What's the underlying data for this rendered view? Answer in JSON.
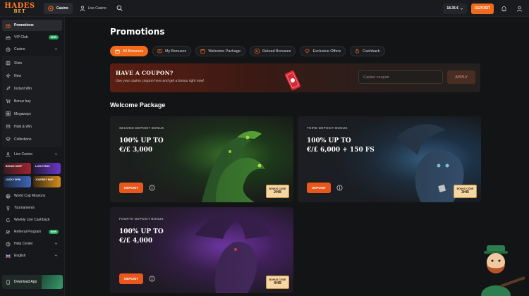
{
  "topbar": {
    "logo_line1": "HADES",
    "logo_line2": "BET",
    "nav": [
      {
        "label": "Casino",
        "active": true
      },
      {
        "label": "Live Casino",
        "active": false
      }
    ],
    "balance": "18.35 €",
    "deposit_label": "DEPOSIT"
  },
  "sidebar": {
    "items_top": [
      {
        "label": "Promotions"
      },
      {
        "label": "VIP Club",
        "badge": "NEW"
      },
      {
        "label": "Casino"
      }
    ],
    "casino_sub": [
      {
        "label": "Slots"
      },
      {
        "label": "New"
      },
      {
        "label": "Instant Win"
      },
      {
        "label": "Bonus buy"
      },
      {
        "label": "Megaways"
      },
      {
        "label": "Hold & Win"
      },
      {
        "label": "Collections"
      }
    ],
    "live_casino": "Live Casino",
    "tiles": [
      "BONUS SHOP",
      "LUCKY BOX",
      "LUCKY SPIN",
      "JOURNEY MAP"
    ],
    "items_bottom": [
      {
        "label": "World Cup Missions"
      },
      {
        "label": "Tournaments"
      },
      {
        "label": "Weekly Live Cashback"
      },
      {
        "label": "Referral Program",
        "badge": "NEW"
      },
      {
        "label": "Help Center"
      },
      {
        "label": "English"
      }
    ],
    "download": "Download App"
  },
  "main": {
    "title": "Promotions",
    "tabs": [
      {
        "label": "All Bonuses",
        "active": true
      },
      {
        "label": "My Bonuses"
      },
      {
        "label": "Welcome Package"
      },
      {
        "label": "Reload Bonuses"
      },
      {
        "label": "Exclusive Offers"
      },
      {
        "label": "Cashback"
      }
    ],
    "coupon": {
      "title": "HAVE A COUPON?",
      "subtitle": "Use your casino coupon here and get a bonus right now!",
      "placeholder": "Casino coupon",
      "apply": "APPLY"
    },
    "section_title": "Welcome Package",
    "cards": [
      {
        "label": "SECOND DEPOSIT BONUS",
        "line1": "100% UP TO",
        "line2": "€/£ 3,000",
        "button": "DEPOSIT",
        "code_title": "BONUS CODE",
        "code": "2HB"
      },
      {
        "label": "THIRD DEPOSIT BONUS",
        "line1": "100% UP TO",
        "line2": "€/£ 6,000 + 150 FS",
        "button": "DEPOSIT",
        "code_title": "BONUS CODE",
        "code": "3HB"
      },
      {
        "label": "FOURTH DEPOSIT BONUS",
        "line1": "100% UP TO",
        "line2": "€/£ 4,000",
        "button": "DEPOSIT",
        "code_title": "BONUS CODE",
        "code": "4HB"
      }
    ]
  },
  "colors": {
    "accent": "#f26b1d",
    "background": "#131416",
    "sidebar": "#17181b",
    "new_badge": "#22a85a"
  }
}
